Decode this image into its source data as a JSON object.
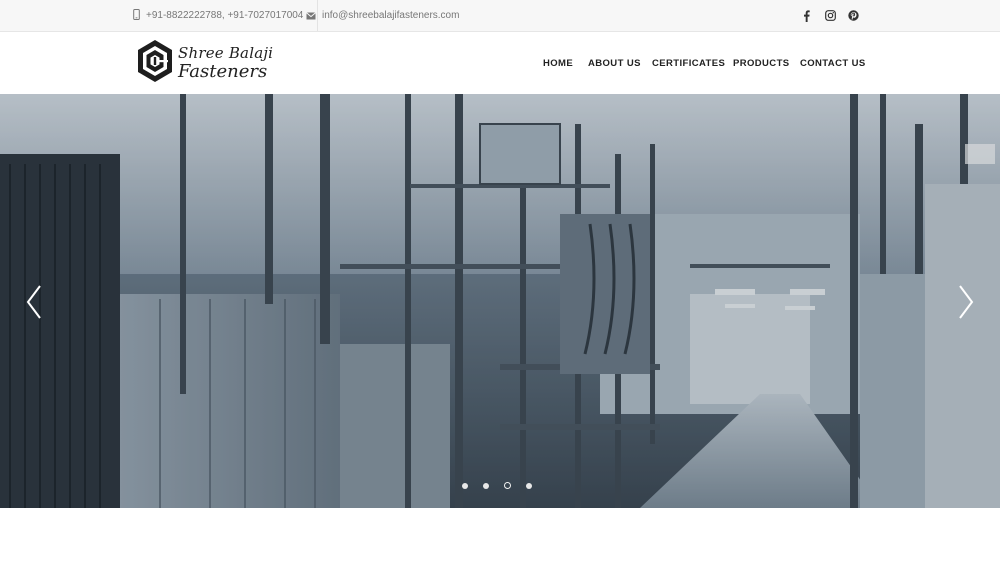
{
  "topbar": {
    "phone_icon": "mobile-phone-icon",
    "phone": "+91-8822222788, +91-7027017004",
    "email_icon": "envelope-icon",
    "email": "info@shreebalajifasteners.com",
    "social": [
      "facebook-icon",
      "instagram-icon",
      "pinterest-icon"
    ]
  },
  "brand": {
    "line1": "Shree Balaji",
    "line2": "Fasteners",
    "logo_icon": "hexagon-logo-icon"
  },
  "nav": {
    "items": [
      {
        "label": "HOME"
      },
      {
        "label": "ABOUT US"
      },
      {
        "label": "CERTIFICATES"
      },
      {
        "label": "PRODUCTS"
      },
      {
        "label": "CONTACT US"
      }
    ]
  },
  "slider": {
    "prev_icon": "chevron-left-icon",
    "next_icon": "chevron-right-icon",
    "slide_count": 4,
    "active_slide": 3,
    "image": "factory-interior-photo"
  },
  "colors": {
    "text_dark": "#222222",
    "text_muted": "#777777",
    "topbar_bg": "#f7f7f7"
  }
}
